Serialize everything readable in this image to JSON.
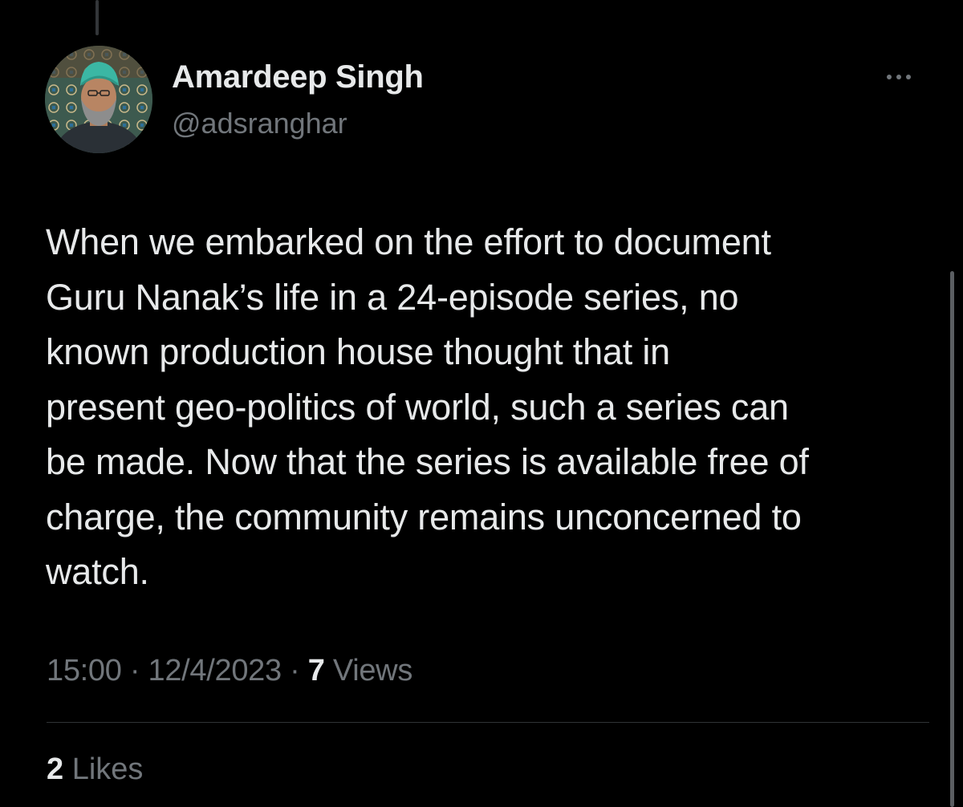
{
  "author": {
    "display_name": "Amardeep Singh",
    "handle": "@adsranghar",
    "avatar_icon": "profile-photo"
  },
  "tweet": {
    "text_lines": [
      "When we embarked on the effort to document",
      "Guru Nanak’s life in a 24-episode series, no",
      "known production house thought that in",
      "present geo-politics of world, such a series can",
      "be made. Now that the series is available free of",
      "charge, the community remains unconcerned to",
      "watch."
    ]
  },
  "meta": {
    "time": "15:00",
    "separator": "·",
    "date": "12/4/2023",
    "views_count": "7",
    "views_label": "Views"
  },
  "engagement": {
    "likes_count": "2",
    "likes_label": "Likes"
  },
  "colors": {
    "background": "#000000",
    "primary_text": "#e7e9ea",
    "secondary_text": "#71767b",
    "divider": "#2f3336"
  },
  "icons": {
    "more": "more-horizontal-icon"
  }
}
